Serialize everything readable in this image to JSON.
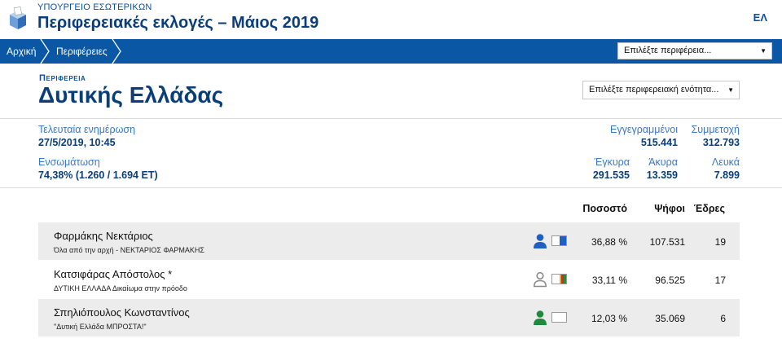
{
  "header": {
    "ministry": "ΥΠΟΥΡΓΕΙΟ ΕΣΩΤΕΡΙΚΩΝ",
    "title": "Περιφερειακές εκλογές – Μάιος 2019",
    "lang": "ΕΛ"
  },
  "nav": {
    "home": "Αρχική",
    "regions": "Περιφέρειες",
    "region_select": "Επιλέξτε περιφέρεια..."
  },
  "region": {
    "label": "Περιφερεια",
    "name": "Δυτικής Ελλάδας",
    "unit_select": "Επιλέξτε περιφερειακή ενότητα..."
  },
  "stats": {
    "last_update_label": "Τελευταία ενημέρωση",
    "last_update": "27/5/2019, 10:45",
    "integration_label": "Ενσωμάτωση",
    "integration": "74,38% (1.260 / 1.694 ΕΤ)",
    "registered_label": "Εγγεγραμμένοι",
    "registered": "515.441",
    "turnout_label": "Συμμετοχή",
    "turnout": "312.793",
    "valid_label": "Έγκυρα",
    "valid": "291.535",
    "invalid_label": "Άκυρα",
    "invalid": "13.359",
    "blank_label": "Λευκά",
    "blank": "7.899"
  },
  "table": {
    "headers": {
      "percent": "Ποσοστό",
      "votes": "Ψήφοι",
      "seats": "Έδρες"
    },
    "rows": [
      {
        "candidate": "Φαρμάκης Νεκτάριος",
        "party": "Όλα από την αρχή - ΝΕΚΤΑΡΙΟΣ ΦΑΡΜΑΚΗΣ",
        "percent": "36,88 %",
        "votes": "107.531",
        "seats": "19",
        "color": "#1f5fbf"
      },
      {
        "candidate": "Κατσιφάρας Απόστολος *",
        "party": "ΔΥΤΙΚΗ ΕΛΛΑΔΑ Δικαίωμα στην πρόοδο",
        "percent": "33,11 %",
        "votes": "96.525",
        "seats": "17",
        "color": "#9a9a9a"
      },
      {
        "candidate": "Σπηλιόπουλος Κωνσταντίνος",
        "party": "\"Δυτική Ελλάδα ΜΠΡΟΣΤΑ!\"",
        "percent": "12,03 %",
        "votes": "35.069",
        "seats": "6",
        "color": "#1e8a3c"
      }
    ]
  }
}
